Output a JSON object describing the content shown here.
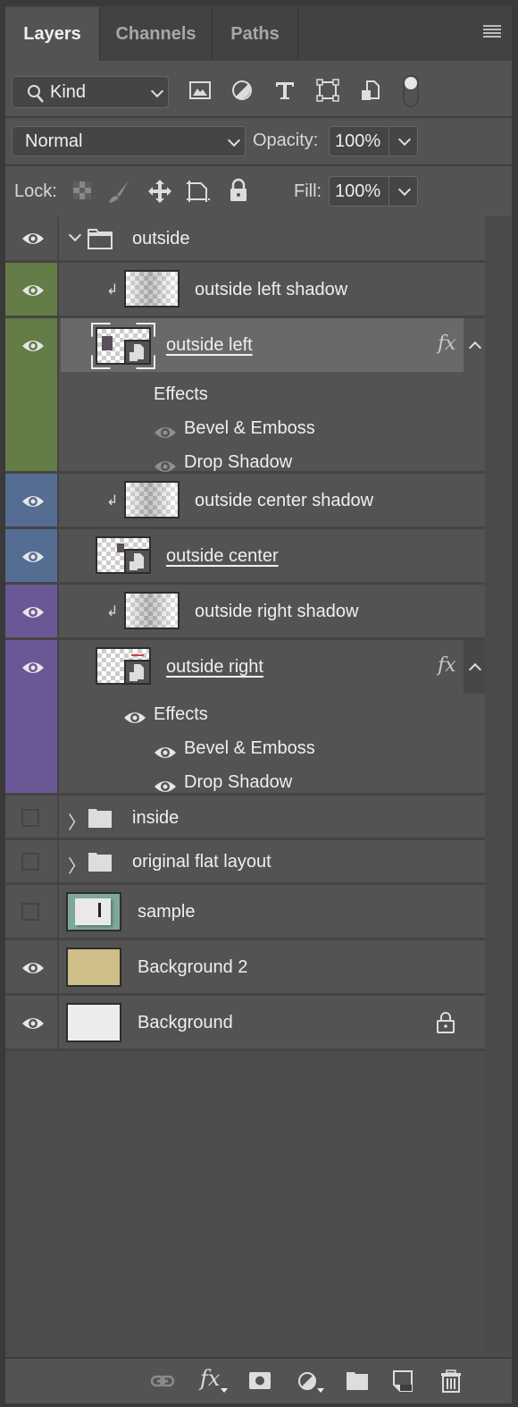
{
  "tabs": [
    {
      "label": "Layers",
      "active": true
    },
    {
      "label": "Channels",
      "active": false
    },
    {
      "label": "Paths",
      "active": false
    }
  ],
  "filter": {
    "kind_label": "Kind",
    "filter_icons": [
      "image-filter-icon",
      "adjustment-filter-icon",
      "type-filter-icon",
      "shape-filter-icon",
      "smart-object-filter-icon",
      "filter-toggle"
    ]
  },
  "blend": {
    "mode": "Normal",
    "opacity_label": "Opacity:",
    "opacity_value": "100%"
  },
  "lock": {
    "label": "Lock:",
    "fill_label": "Fill:",
    "fill_value": "100%"
  },
  "colors": {
    "green": "#647c45",
    "blue": "#566d93",
    "purple": "#6a5796",
    "selected": "#696969",
    "bg2_swatch": "#cdbf87",
    "bg_swatch": "#ebecec"
  },
  "layers": [
    {
      "name": "outside",
      "type": "group",
      "expanded": true,
      "visible": true
    },
    {
      "name": "outside left shadow",
      "type": "clipped",
      "visible": true,
      "color": "green"
    },
    {
      "name": "outside left",
      "type": "smart",
      "visible": true,
      "color": "green",
      "selected": true,
      "fx": "fx",
      "effects_label": "Effects",
      "effects": [
        "Bevel & Emboss",
        "Drop Shadow"
      ]
    },
    {
      "name": "outside center shadow",
      "type": "clipped",
      "visible": true,
      "color": "blue"
    },
    {
      "name": "outside center",
      "type": "smart",
      "visible": true,
      "color": "blue"
    },
    {
      "name": "outside right shadow",
      "type": "clipped",
      "visible": true,
      "color": "purple"
    },
    {
      "name": "outside right",
      "type": "smart",
      "visible": true,
      "color": "purple",
      "fx": "fx",
      "effects_label": "Effects",
      "effects": [
        "Bevel & Emboss",
        "Drop Shadow"
      ]
    },
    {
      "name": "inside",
      "type": "group",
      "expanded": false,
      "visible": false
    },
    {
      "name": "original flat layout",
      "type": "group",
      "expanded": false,
      "visible": false
    },
    {
      "name": "sample",
      "type": "image",
      "visible": false
    },
    {
      "name": "Background 2",
      "type": "fill",
      "visible": true
    },
    {
      "name": "Background",
      "type": "fill",
      "visible": true,
      "locked": true
    }
  ],
  "footer": {
    "buttons": [
      "link-layers",
      "add-layer-style",
      "add-mask",
      "new-adjustment-layer",
      "new-group",
      "new-layer",
      "delete-layer"
    ],
    "fx_label": "fx"
  }
}
